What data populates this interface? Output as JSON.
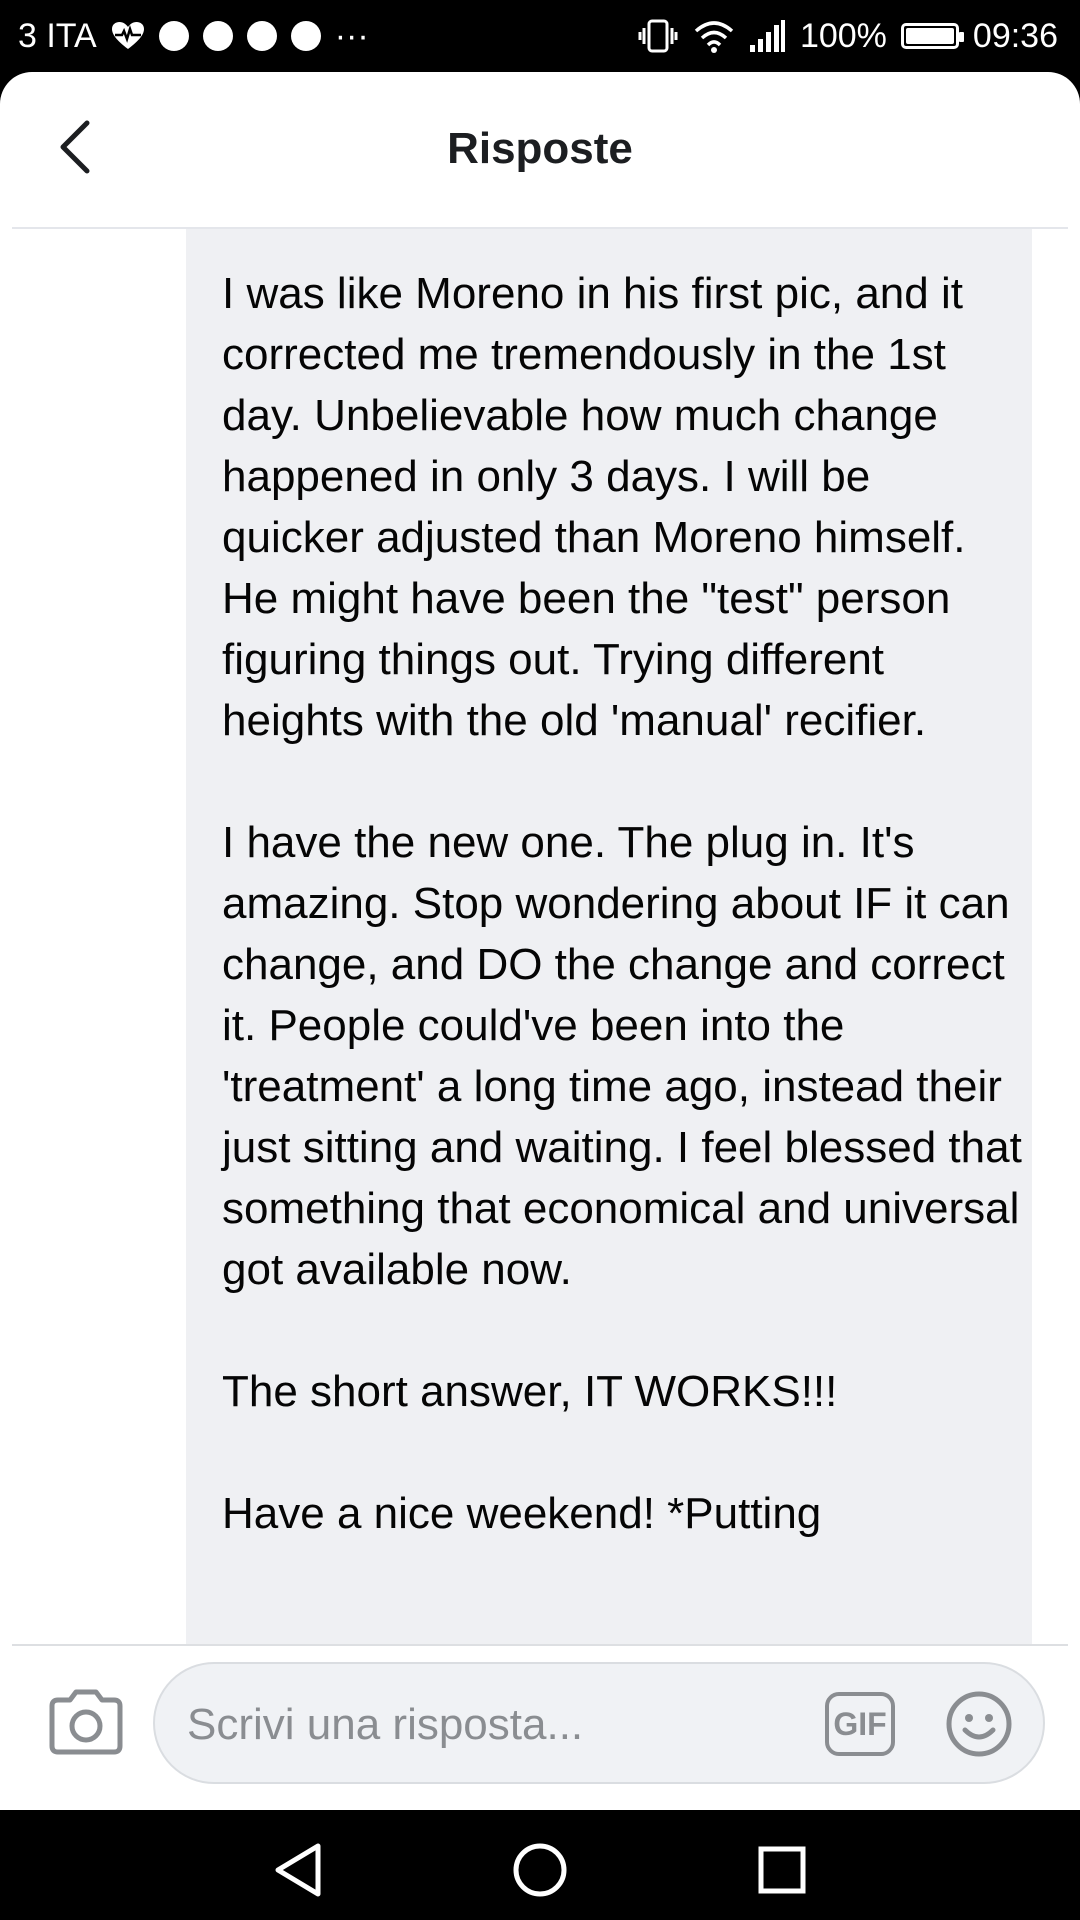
{
  "status_bar": {
    "carrier": "3 ITA",
    "overflow": "···",
    "battery_percent": "100%",
    "battery_level": 1.0,
    "time": "09:36",
    "icons": [
      "heart-rate-icon",
      "soccer-icon",
      "messenger-icon",
      "chrome-icon",
      "upload-icon",
      "vibrate-icon",
      "wifi-icon",
      "signal-icon",
      "battery-icon"
    ]
  },
  "header": {
    "title": "Risposte",
    "back_icon": "chevron-left-icon"
  },
  "comment": {
    "paragraphs": [
      "I was like Moreno in his first pic, and it corrected me tremendously in the 1st day. Unbelievable how much change happened in only 3 days. I will be quicker adjusted than Moreno himself. He might have been the \"test\" person figuring things out. Trying different heights with the old 'manual' recifier.",
      "I have the new one. The plug in. It's amazing. Stop wondering about IF it can change, and DO the change and correct it. People could've been into the 'treatment' a long time ago, instead their just sitting and waiting. I feel blessed that something that economical and universal got available now.",
      "The short answer, IT WORKS!!!",
      "Have a nice weekend! *Putting"
    ]
  },
  "composer": {
    "placeholder": "Scrivi una risposta...",
    "value": "",
    "gif_label": "GIF",
    "camera_icon": "camera-icon",
    "emoji_icon": "smiley-icon"
  },
  "navbar": {
    "icons": [
      "back-triangle-icon",
      "home-circle-icon",
      "recents-square-icon"
    ]
  },
  "colors": {
    "bubble": "#eff0f3",
    "text": "#050505",
    "icon_gray": "#8a8d91"
  }
}
